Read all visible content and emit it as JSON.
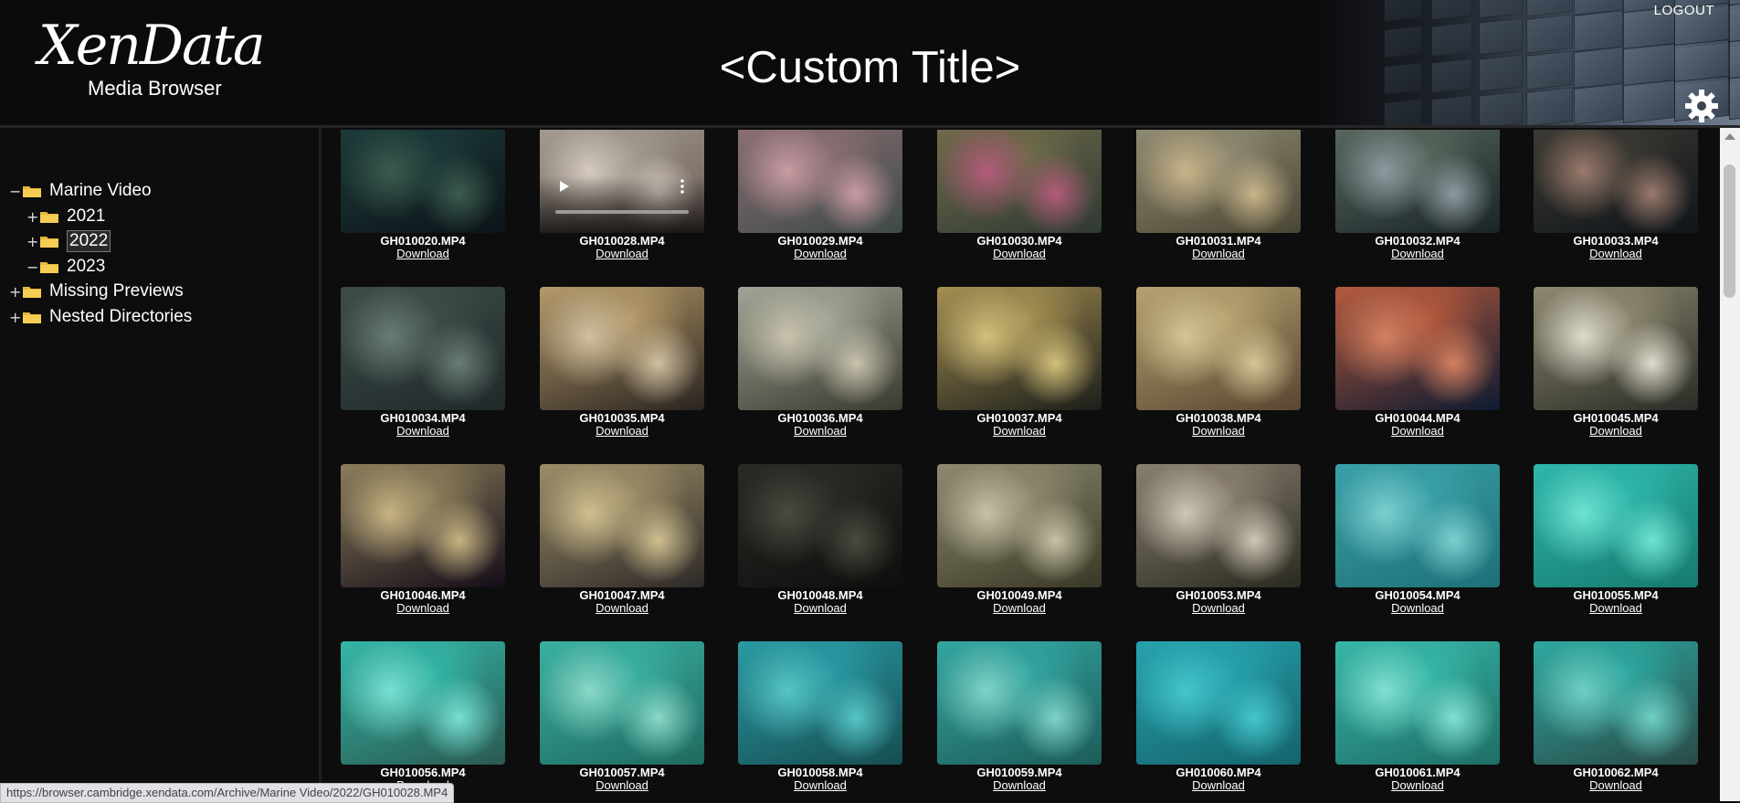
{
  "header": {
    "logo_main": "XenData",
    "logo_sub": "Media Browser",
    "title": "<Custom Title>",
    "logout": "LOGOUT",
    "settings_icon": "gear-icon"
  },
  "tree": [
    {
      "label": "Marine Video",
      "toggle": "−",
      "level": 0,
      "expanded": true
    },
    {
      "label": "2021",
      "toggle": "+",
      "level": 1
    },
    {
      "label": "2022",
      "toggle": "+",
      "level": 1,
      "selected": true
    },
    {
      "label": "2023",
      "toggle": "−",
      "level": 1
    },
    {
      "label": "Missing Previews",
      "toggle": "+",
      "level": 0
    },
    {
      "label": "Nested Directories",
      "toggle": "+",
      "level": 0
    }
  ],
  "download_label": "Download",
  "videos": [
    {
      "name": "GH010020.MP4",
      "c1": "#1d3a3a",
      "c2": "#3c5b4e",
      "c3": "#0c1418"
    },
    {
      "name": "GH010028.MP4",
      "c1": "#a29a90",
      "c2": "#d4cac0",
      "c3": "#6c5e58",
      "hover": true
    },
    {
      "name": "GH010029.MP4",
      "c1": "#8a6e72",
      "c2": "#c99ba3",
      "c3": "#3e4a48"
    },
    {
      "name": "GH010030.MP4",
      "c1": "#6f6a4a",
      "c2": "#b25b7a",
      "c3": "#2f3a33"
    },
    {
      "name": "GH010031.MP4",
      "c1": "#8f8a72",
      "c2": "#c8b48a",
      "c3": "#4a4634"
    },
    {
      "name": "GH010032.MP4",
      "c1": "#57675d",
      "c2": "#8f9aa0",
      "c3": "#1a2427"
    },
    {
      "name": "GH010033.MP4",
      "c1": "#3c3a33",
      "c2": "#9a7a6c",
      "c3": "#10151a"
    },
    {
      "name": "GH010034.MP4",
      "c1": "#3d4d49",
      "c2": "#6a7d76",
      "c3": "#20292a"
    },
    {
      "name": "GH010035.MP4",
      "c1": "#b59a6a",
      "c2": "#d0c0a0",
      "c3": "#2a2420"
    },
    {
      "name": "GH010036.MP4",
      "c1": "#a0a596",
      "c2": "#c9c2ad",
      "c3": "#3a3a30"
    },
    {
      "name": "GH010037.MP4",
      "c1": "#a48f52",
      "c2": "#d3c07a",
      "c3": "#1c1e1a"
    },
    {
      "name": "GH010038.MP4",
      "c1": "#b6a270",
      "c2": "#d4c595",
      "c3": "#5a4632"
    },
    {
      "name": "GH010044.MP4",
      "c1": "#b55a3e",
      "c2": "#d48060",
      "c3": "#0d1a30"
    },
    {
      "name": "GH010045.MP4",
      "c1": "#8d8870",
      "c2": "#e0dccd",
      "c3": "#2a2c26"
    },
    {
      "name": "GH010046.MP4",
      "c1": "#8c7e5c",
      "c2": "#c7b482",
      "c3": "#140d18"
    },
    {
      "name": "GH010047.MP4",
      "c1": "#9d8e68",
      "c2": "#d0c090",
      "c3": "#2e2a28"
    },
    {
      "name": "GH010048.MP4",
      "c1": "#2a2a26",
      "c2": "#4a4a40",
      "c3": "#0e0f0d"
    },
    {
      "name": "GH010049.MP4",
      "c1": "#8e8a70",
      "c2": "#c6c2a6",
      "c3": "#3a3826"
    },
    {
      "name": "GH010053.MP4",
      "c1": "#8a8070",
      "c2": "#cfc6b6",
      "c3": "#2a2a20"
    },
    {
      "name": "GH010054.MP4",
      "c1": "#3aa1a8",
      "c2": "#7ccfcf",
      "c3": "#1e7078"
    },
    {
      "name": "GH010055.MP4",
      "c1": "#2fb7ab",
      "c2": "#6ee3d3",
      "c3": "#167a70"
    },
    {
      "name": "GH010056.MP4",
      "c1": "#33b6a6",
      "c2": "#78e0d2",
      "c3": "#2a5a52"
    },
    {
      "name": "GH010057.MP4",
      "c1": "#3ab0a0",
      "c2": "#8ad8c8",
      "c3": "#1f6a60"
    },
    {
      "name": "GH010058.MP4",
      "c1": "#2a9aa4",
      "c2": "#56c4c4",
      "c3": "#164e52"
    },
    {
      "name": "GH010059.MP4",
      "c1": "#33a6a2",
      "c2": "#7fd3c6",
      "c3": "#1d5c58"
    },
    {
      "name": "GH010060.MP4",
      "c1": "#27a3ae",
      "c2": "#45c6cc",
      "c3": "#14636c"
    },
    {
      "name": "GH010061.MP4",
      "c1": "#37b7a8",
      "c2": "#80e0d0",
      "c3": "#1e6e66"
    },
    {
      "name": "GH010062.MP4",
      "c1": "#2da8a0",
      "c2": "#6ed0c4",
      "c3": "#2a4a48"
    }
  ],
  "status_url": "https://browser.cambridge.xendata.com/Archive/Marine Video/2022/GH010028.MP4"
}
